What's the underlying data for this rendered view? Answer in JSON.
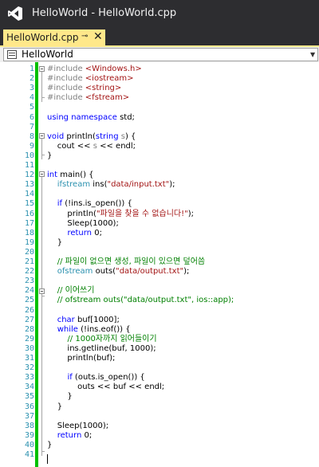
{
  "window": {
    "title": "HelloWorld - HelloWorld.cpp"
  },
  "tab": {
    "label": "HelloWorld.cpp",
    "pin_glyph": "⊸",
    "close_glyph": "✕"
  },
  "navigation": {
    "scope": "HelloWorld",
    "dropdown_icon": "chevron-down-icon"
  },
  "colors": {
    "keyword": "#0000ff",
    "type": "#2b91af",
    "string": "#a31515",
    "comment": "#008000",
    "preprocessor": "#808080",
    "line_number": "#2b91af",
    "change_bar": "#00c000",
    "active_tab": "#ffe88a",
    "chrome": "#2d2d30"
  },
  "editor": {
    "lines": [
      [
        [
          "pp",
          "#include "
        ],
        [
          "st",
          "<Windows.h>"
        ]
      ],
      [
        [
          "pp",
          "#include "
        ],
        [
          "st",
          "<iostream>"
        ]
      ],
      [
        [
          "pp",
          "#include "
        ],
        [
          "st",
          "<string>"
        ]
      ],
      [
        [
          "pp",
          "#include "
        ],
        [
          "st",
          "<fstream>"
        ]
      ],
      [],
      [
        [
          "kw",
          "using namespace "
        ],
        [
          "",
          "std;"
        ]
      ],
      [],
      [
        [
          "kw",
          "void "
        ],
        [
          "",
          "println("
        ],
        [
          "kw",
          "string "
        ],
        [
          "pp",
          "s"
        ],
        [
          "",
          ") {"
        ]
      ],
      [
        [
          "",
          "    cout << "
        ],
        [
          "pp",
          "s"
        ],
        [
          "",
          " << endl;"
        ]
      ],
      [
        [
          "",
          "}"
        ]
      ],
      [],
      [
        [
          "kw",
          "int "
        ],
        [
          "",
          "main() {"
        ]
      ],
      [
        [
          "",
          "    "
        ],
        [
          "ty",
          "ifstream "
        ],
        [
          "",
          "ins("
        ],
        [
          "st",
          "\"data/input.txt\""
        ],
        [
          "",
          ");"
        ]
      ],
      [],
      [
        [
          "",
          "    "
        ],
        [
          "kw",
          "if "
        ],
        [
          "",
          "(!ins.is_open()) {"
        ]
      ],
      [
        [
          "",
          "        println("
        ],
        [
          "st",
          "\"파일을 찾을 수 없습니다!\""
        ],
        [
          "",
          ");"
        ]
      ],
      [
        [
          "",
          "        Sleep(1000);"
        ]
      ],
      [
        [
          "",
          "        "
        ],
        [
          "kw",
          "return "
        ],
        [
          "",
          "0;"
        ]
      ],
      [
        [
          "",
          "    }"
        ]
      ],
      [],
      [
        [
          "",
          "    "
        ],
        [
          "cm",
          "// 파일이 없으면 생성, 파일이 있으면 덮어씀"
        ]
      ],
      [
        [
          "",
          "    "
        ],
        [
          "ty",
          "ofstream "
        ],
        [
          "",
          "outs("
        ],
        [
          "st",
          "\"data/output.txt\""
        ],
        [
          "",
          ");"
        ]
      ],
      [],
      [
        [
          "",
          "    "
        ],
        [
          "cm",
          "// 이어쓰기"
        ]
      ],
      [
        [
          "",
          "    "
        ],
        [
          "cm",
          "// ofstream outs(\"data/output.txt\", ios::app);"
        ]
      ],
      [],
      [
        [
          "",
          "    "
        ],
        [
          "kw",
          "char "
        ],
        [
          "",
          "buf[1000];"
        ]
      ],
      [
        [
          "",
          "    "
        ],
        [
          "kw",
          "while "
        ],
        [
          "",
          "(!ins.eof()) {"
        ]
      ],
      [
        [
          "",
          "        "
        ],
        [
          "cm",
          "// 1000자까지 읽어들이기"
        ]
      ],
      [
        [
          "",
          "        ins.getline(buf, 1000);"
        ]
      ],
      [
        [
          "",
          "        println(buf);"
        ]
      ],
      [],
      [
        [
          "",
          "        "
        ],
        [
          "kw",
          "if "
        ],
        [
          "",
          "(outs.is_open()) {"
        ]
      ],
      [
        [
          "",
          "            outs << buf << endl;"
        ]
      ],
      [
        [
          "",
          "        }"
        ]
      ],
      [
        [
          "",
          "    }"
        ]
      ],
      [],
      [
        [
          "",
          "    Sleep(1000);"
        ]
      ],
      [
        [
          "",
          "    "
        ],
        [
          "kw",
          "return "
        ],
        [
          "",
          "0;"
        ]
      ],
      [
        [
          "",
          "}"
        ]
      ],
      []
    ]
  }
}
